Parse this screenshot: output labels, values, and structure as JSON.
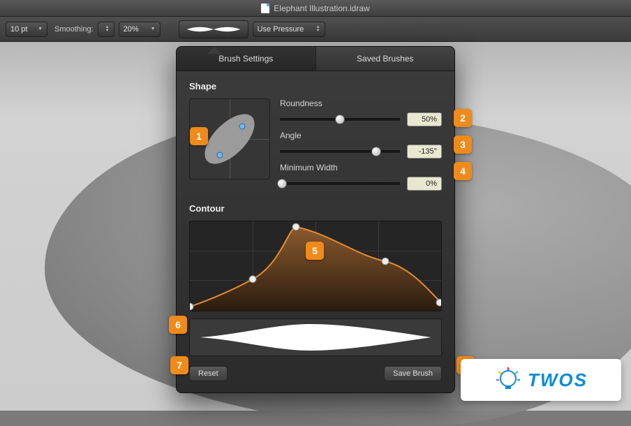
{
  "titlebar": {
    "filename": "Elephant Illustration.idraw"
  },
  "toolbar": {
    "stroke_width": "10 pt",
    "smoothing_label": "Smoothing:",
    "smoothing_value": "20%",
    "pressure_label": "Use Pressure"
  },
  "tabs": {
    "brush_settings": "Brush Settings",
    "saved_brushes": "Saved Brushes"
  },
  "shape": {
    "title": "Shape",
    "roundness_label": "Roundness",
    "roundness_value": "50%",
    "roundness_pct": 50,
    "angle_label": "Angle",
    "angle_value": "-135°",
    "angle_pct": 80,
    "minwidth_label": "Minimum Width",
    "minwidth_value": "0%",
    "minwidth_pct": 2
  },
  "contour": {
    "title": "Contour"
  },
  "footer": {
    "reset": "Reset",
    "save_brush": "Save Brush"
  },
  "markers": {
    "m1": "1",
    "m2": "2",
    "m3": "3",
    "m4": "4",
    "m5": "5",
    "m6": "6",
    "m7": "7",
    "m8": "8"
  },
  "watermark": {
    "text": "TWOS"
  },
  "chart_data": {
    "type": "line",
    "title": "Contour",
    "xlabel": "",
    "ylabel": "",
    "xlim": [
      0,
      100
    ],
    "ylim": [
      0,
      100
    ],
    "series": [
      {
        "name": "contour",
        "x": [
          0,
          25,
          42,
          78,
          100
        ],
        "y": [
          5,
          35,
          95,
          55,
          10
        ]
      }
    ]
  }
}
